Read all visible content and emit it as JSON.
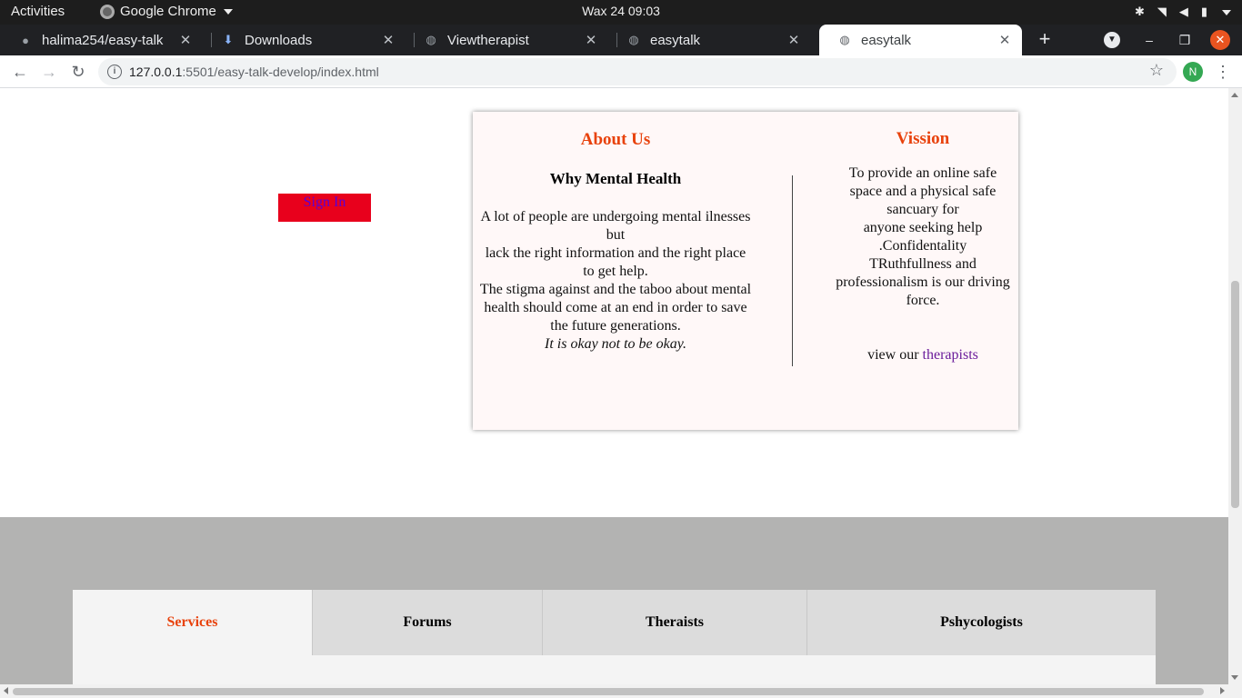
{
  "system_bar": {
    "activities": "Activities",
    "app_name": "Google Chrome",
    "clock": "Wax 24  09:03"
  },
  "browser": {
    "tabs": [
      {
        "title": "halima254/easy-talk",
        "favicon": "github-icon"
      },
      {
        "title": "Downloads",
        "favicon": "download-icon"
      },
      {
        "title": "Viewtherapist",
        "favicon": "globe-icon"
      },
      {
        "title": "easytalk",
        "favicon": "globe-icon"
      },
      {
        "title": "easytalk",
        "favicon": "globe-icon",
        "active": true
      }
    ],
    "url_host": "127.0.0.1",
    "url_path": ":5501/easy-talk-develop/index.html",
    "profile_initial": "N"
  },
  "page": {
    "signin_label": "Sign In",
    "about": {
      "heading": "About Us",
      "subheading": "Why Mental Health",
      "lines": [
        "A lot of people are undergoing mental ilnesses",
        "but",
        "lack the right information and the right place",
        "to get help.",
        "The stigma against and the taboo about mental",
        "health should come at an end in order to save",
        "the future generations."
      ],
      "tagline": "It is okay not to be okay."
    },
    "vision": {
      "heading": "Vission",
      "lines": [
        "To provide an online safe",
        "space and a physical safe",
        "sancuary for",
        "anyone seeking help",
        ".Confidentality",
        "TRuthfullness and",
        "professionalism is our driving",
        "force."
      ],
      "view_prefix": "view our ",
      "view_link": "therapists"
    },
    "services": [
      {
        "label": "Services",
        "active": true
      },
      {
        "label": "Forums"
      },
      {
        "label": "Theraists"
      },
      {
        "label": "Pshycologists"
      }
    ]
  },
  "colors": {
    "accent_orange": "#e8420c",
    "signin_bg": "#e8001c",
    "signin_text": "#5a00d6",
    "link_purple": "#6a1b9a",
    "footer_gray": "#b3b3b2"
  }
}
